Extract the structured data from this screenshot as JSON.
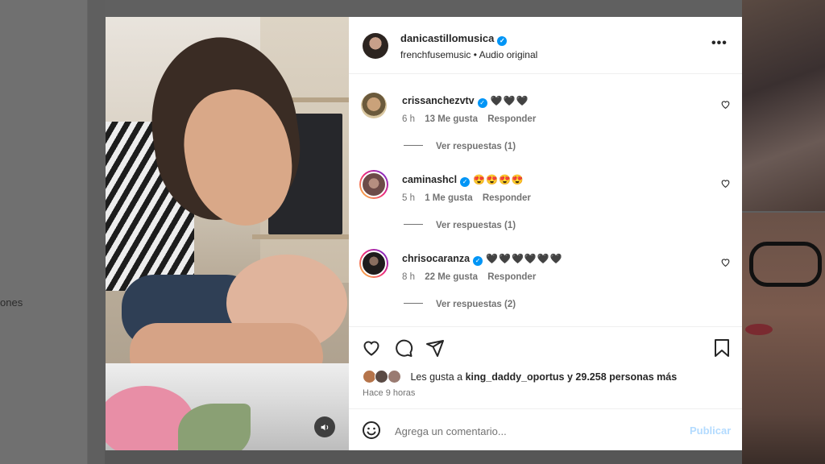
{
  "background": {
    "left_text": "ones"
  },
  "post": {
    "author": "danicastillomusica",
    "audio": "frenchfusemusic • Audio original",
    "likes_prefix": "Les gusta a",
    "likes_user": "king_daddy_oportus",
    "likes_suffix": "y 29.258 personas más",
    "time_ago": "Hace 9 horas"
  },
  "comments": [
    {
      "user": "crissanchezvtv",
      "text": "🖤🖤🖤",
      "age": "6 h",
      "likes": "13 Me gusta",
      "reply": "Responder",
      "replies": "Ver respuestas (1)"
    },
    {
      "user": "caminashcl",
      "text": "😍😍😍😍",
      "age": "5 h",
      "likes": "1 Me gusta",
      "reply": "Responder",
      "replies": "Ver respuestas (1)"
    },
    {
      "user": "chrisocaranza",
      "text": "🖤🖤🖤🖤🖤🖤",
      "age": "8 h",
      "likes": "22 Me gusta",
      "reply": "Responder",
      "replies": "Ver respuestas (2)"
    }
  ],
  "add_comment": {
    "placeholder": "Agrega un comentario...",
    "publish": "Publicar"
  },
  "colors": {
    "verified": "#0095f6",
    "publish_disabled": "#b3dbff",
    "text": "#262626",
    "muted": "#737373"
  },
  "icons": [
    "verified-badge-icon",
    "more-options-icon",
    "heart-icon",
    "comment-icon",
    "share-icon",
    "bookmark-icon",
    "volume-icon",
    "emoji-icon"
  ]
}
